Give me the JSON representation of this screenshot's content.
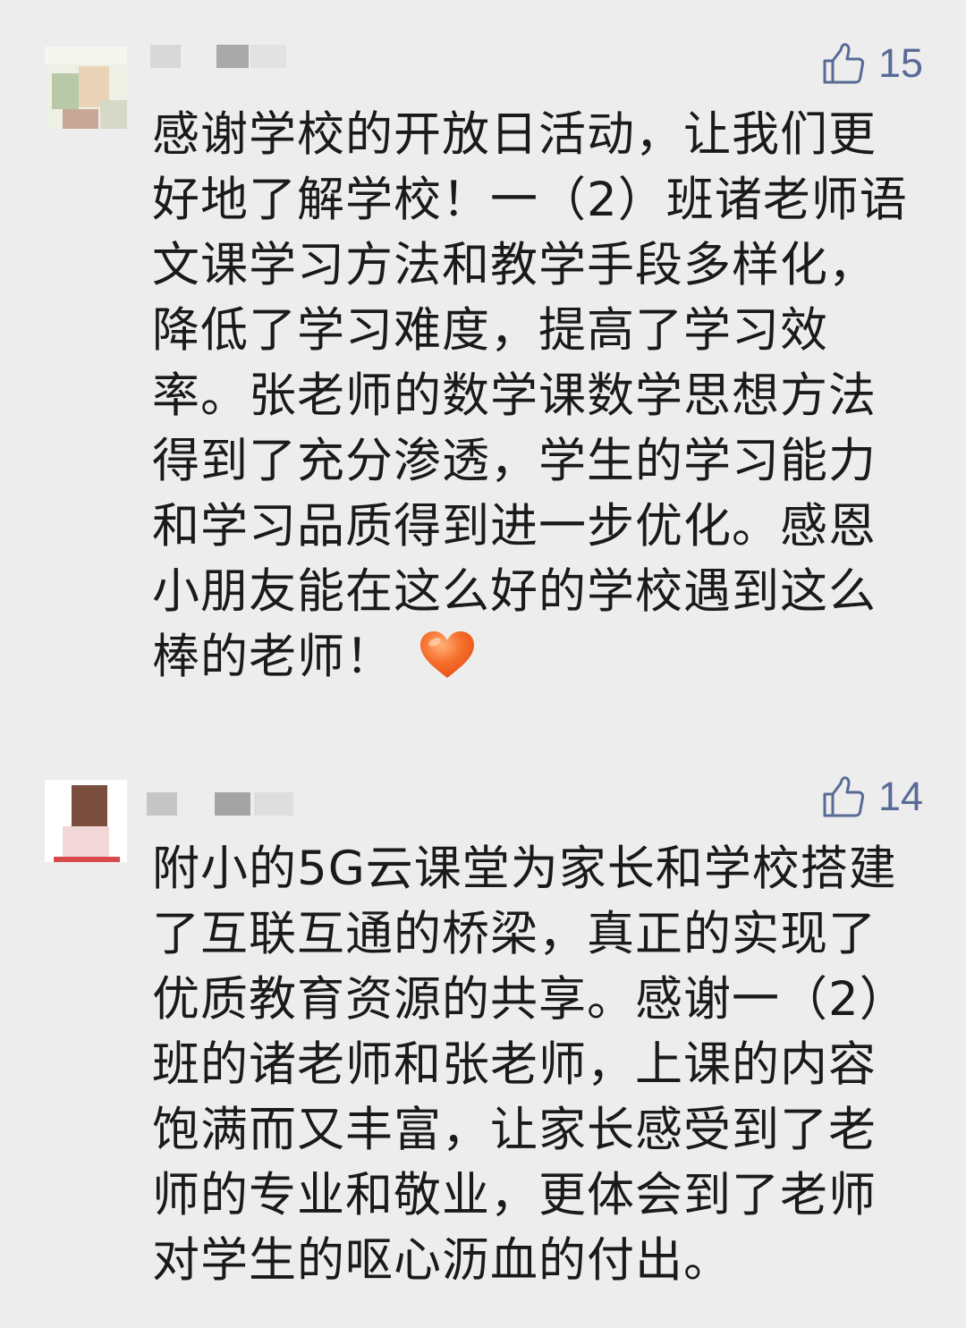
{
  "colors": {
    "background": "#ededed",
    "text": "#1a1a1a",
    "link": "#576b95",
    "heart": "#f45a1c"
  },
  "comments": [
    {
      "likes": "15",
      "like_icon": "thumbs-up-icon",
      "lines": [
        "感谢学校的开放日活动，让我们更",
        "好地了解学校！一（2）班诸老师语",
        "文课学习方法和教学手段多样化，",
        "降低了学习难度，提高了学习效",
        "率。张老师的数学课数学思想方法",
        "得到了充分渗透，学生的学习能力",
        "和学习品质得到进一步优化。感恩",
        "小朋友能在这么好的学校遇到这么",
        "棒的老师！"
      ],
      "emoji": "heart-icon"
    },
    {
      "likes": "14",
      "like_icon": "thumbs-up-icon",
      "lines": [
        "附小的5G云课堂为家长和学校搭建",
        "了互联互通的桥梁，真正的实现了",
        "优质教育资源的共享。感谢一（2）",
        "班的诸老师和张老师，上课的内容",
        "饱满而又丰富，让家长感受到了老",
        "师的专业和敬业，更体会到了老师",
        "对学生的呕心沥血的付出。"
      ]
    }
  ]
}
